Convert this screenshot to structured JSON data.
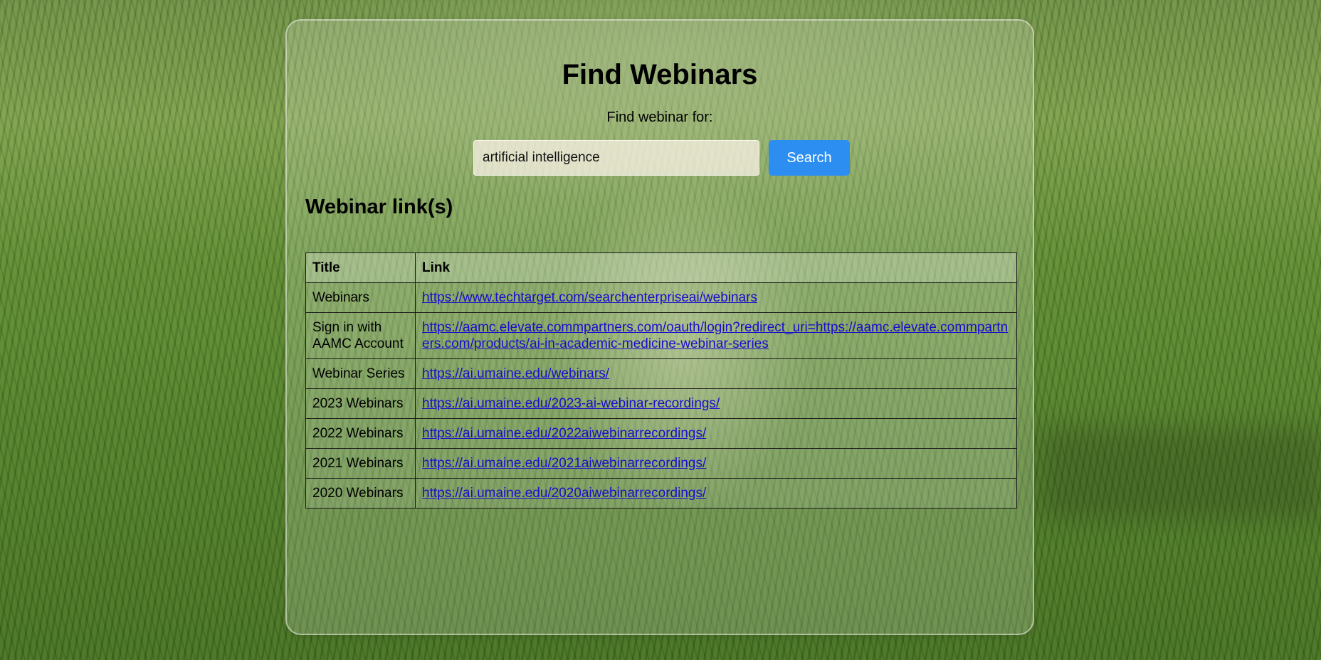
{
  "page": {
    "title": "Find Webinars",
    "find_label": "Find webinar for:"
  },
  "search": {
    "value": "artificial intelligence",
    "button_label": "Search"
  },
  "results": {
    "heading": "Webinar link(s)",
    "columns": [
      "Title",
      "Link"
    ],
    "rows": [
      {
        "title": "Webinars",
        "link": "https://www.techtarget.com/searchenterpriseai/webinars"
      },
      {
        "title": "Sign in with AAMC Account",
        "link": "https://aamc.elevate.commpartners.com/oauth/login?redirect_uri=https://aamc.elevate.commpartners.com/products/ai-in-academic-medicine-webinar-series"
      },
      {
        "title": "Webinar Series",
        "link": "https://ai.umaine.edu/webinars/"
      },
      {
        "title": "2023 Webinars",
        "link": "https://ai.umaine.edu/2023-ai-webinar-recordings/"
      },
      {
        "title": "2022 Webinars",
        "link": "https://ai.umaine.edu/2022aiwebinarrecordings/"
      },
      {
        "title": "2021 Webinars",
        "link": "https://ai.umaine.edu/2021aiwebinarrecordings/"
      },
      {
        "title": "2020 Webinars",
        "link": "https://ai.umaine.edu/2020aiwebinarrecordings/"
      }
    ]
  },
  "colors": {
    "button": "#2b8ef0",
    "link": "#1a0dcc"
  }
}
